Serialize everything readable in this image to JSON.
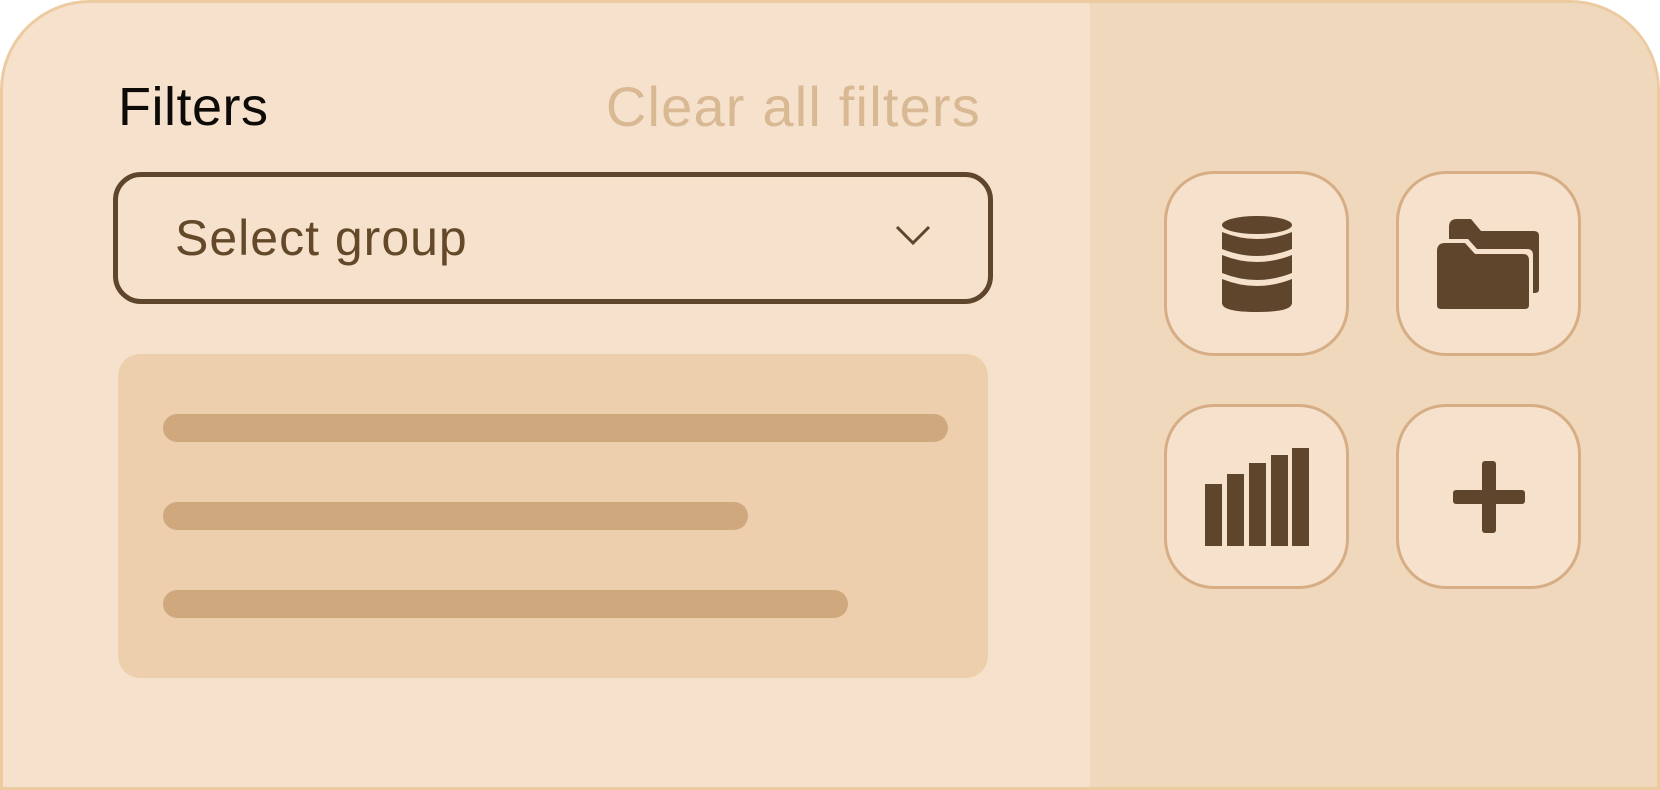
{
  "filters": {
    "title": "Filters",
    "clear_label": "Clear all filters",
    "select": {
      "label": "Select group",
      "icon": "chevron-down-icon"
    }
  },
  "quick_actions": [
    {
      "icon": "database-icon"
    },
    {
      "icon": "folder-icon"
    },
    {
      "icon": "bar-chart-icon"
    },
    {
      "icon": "plus-icon"
    }
  ],
  "colors": {
    "background": "#f6e2cc",
    "side_panel": "#f0d8bd",
    "accent": "#5f452b",
    "muted": "#d9b994",
    "skeleton": "#d0a87d"
  }
}
